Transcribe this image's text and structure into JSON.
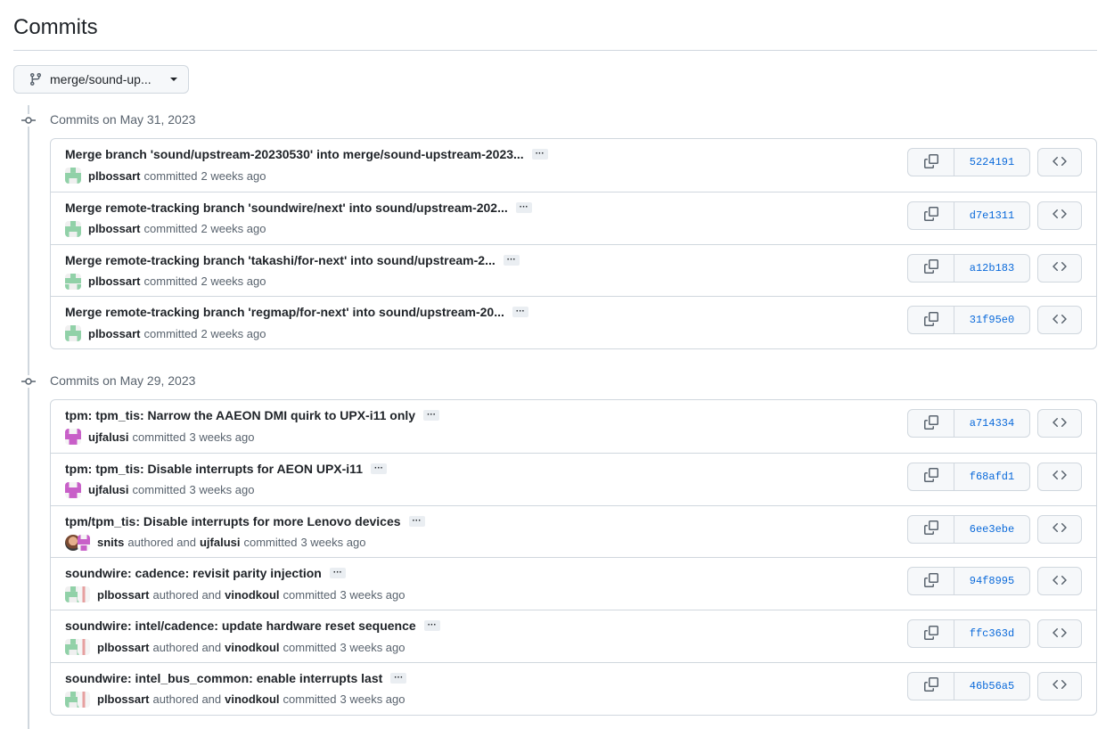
{
  "page": {
    "title": "Commits"
  },
  "branch": {
    "label": "merge/sound-up..."
  },
  "groups": [
    {
      "label": "Commits on May 31, 2023",
      "commits": [
        {
          "title": "Merge branch 'sound/upstream-20230530' into merge/sound-upstream-2023...",
          "author": "plbossart",
          "committer": "",
          "time": "2 weeks ago",
          "sha": "5224191",
          "avatar": "av-green"
        },
        {
          "title": "Merge remote-tracking branch 'soundwire/next' into sound/upstream-202...",
          "author": "plbossart",
          "committer": "",
          "time": "2 weeks ago",
          "sha": "d7e1311",
          "avatar": "av-green"
        },
        {
          "title": "Merge remote-tracking branch 'takashi/for-next' into sound/upstream-2...",
          "author": "plbossart",
          "committer": "",
          "time": "2 weeks ago",
          "sha": "a12b183",
          "avatar": "av-green"
        },
        {
          "title": "Merge remote-tracking branch 'regmap/for-next' into sound/upstream-20...",
          "author": "plbossart",
          "committer": "",
          "time": "2 weeks ago",
          "sha": "31f95e0",
          "avatar": "av-green"
        }
      ]
    },
    {
      "label": "Commits on May 29, 2023",
      "commits": [
        {
          "title": "tpm: tpm_tis: Narrow the AAEON DMI quirk to UPX-i11 only",
          "author": "ujfalusi",
          "committer": "",
          "time": "3 weeks ago",
          "sha": "a714334",
          "avatar": "av-pink"
        },
        {
          "title": "tpm: tpm_tis: Disable interrupts for AEON UPX-i11",
          "author": "ujfalusi",
          "committer": "",
          "time": "3 weeks ago",
          "sha": "f68afd1",
          "avatar": "av-pink"
        },
        {
          "title": "tpm/tpm_tis: Disable interrupts for more Lenovo devices",
          "author": "snits",
          "committer": "ujfalusi",
          "time": "3 weeks ago",
          "sha": "6ee3ebe",
          "avatar": "av-photo",
          "avatar2": "av-pink"
        },
        {
          "title": "soundwire: cadence: revisit parity injection",
          "author": "plbossart",
          "committer": "vinodkoul",
          "time": "3 weeks ago",
          "sha": "94f8995",
          "avatar": "av-green",
          "avatar2": "av-red"
        },
        {
          "title": "soundwire: intel/cadence: update hardware reset sequence",
          "author": "plbossart",
          "committer": "vinodkoul",
          "time": "3 weeks ago",
          "sha": "ffc363d",
          "avatar": "av-green",
          "avatar2": "av-red"
        },
        {
          "title": "soundwire: intel_bus_common: enable interrupts last",
          "author": "plbossart",
          "committer": "vinodkoul",
          "time": "3 weeks ago",
          "sha": "46b56a5",
          "avatar": "av-green",
          "avatar2": "av-red"
        }
      ]
    }
  ],
  "strings": {
    "committed": "committed",
    "authored_and": "authored and",
    "ellipsis": "···"
  },
  "icons": {
    "branch": "git-branch-icon",
    "copy": "copy-icon",
    "code": "code-icon",
    "commit_node": "git-commit-icon"
  }
}
